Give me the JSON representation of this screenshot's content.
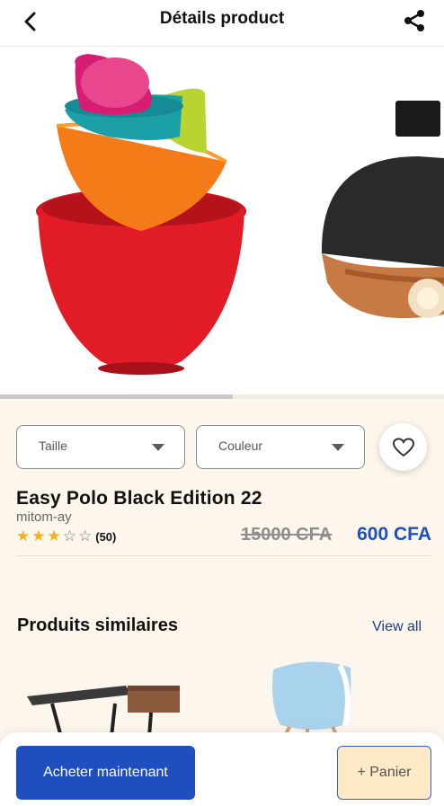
{
  "header": {
    "title": "Détails product",
    "back_icon": "chevron-left-icon",
    "share_icon": "share-icon"
  },
  "gallery": {
    "images": [
      {
        "name": "mixing-bowls-image",
        "alt": "Colorful mixing bowls"
      },
      {
        "name": "pendant-lamp-image",
        "alt": "Black pendant lamp"
      }
    ],
    "progress_fraction": 0.525
  },
  "options": {
    "size_label": "Taille",
    "color_label": "Couleur",
    "favorite_icon": "heart-icon"
  },
  "product": {
    "name": "Easy Polo Black Edition 22",
    "seller": "mitom-ay",
    "rating": 3,
    "rating_max": 5,
    "rating_count": "(50)",
    "old_price": "15000 CFA",
    "price": "600 CFA"
  },
  "similar": {
    "title": "Produits similaires",
    "view_all": "View all",
    "items": [
      {
        "name": "desk-thumbnail"
      },
      {
        "name": "chair-thumbnail"
      }
    ]
  },
  "actions": {
    "buy_label": "Acheter maintenant",
    "cart_label": "+ Panier"
  },
  "colors": {
    "primary": "#1f4fbf",
    "background": "#fdf6ec",
    "cart_bg": "#fde9c6",
    "star": "#f0b020"
  }
}
